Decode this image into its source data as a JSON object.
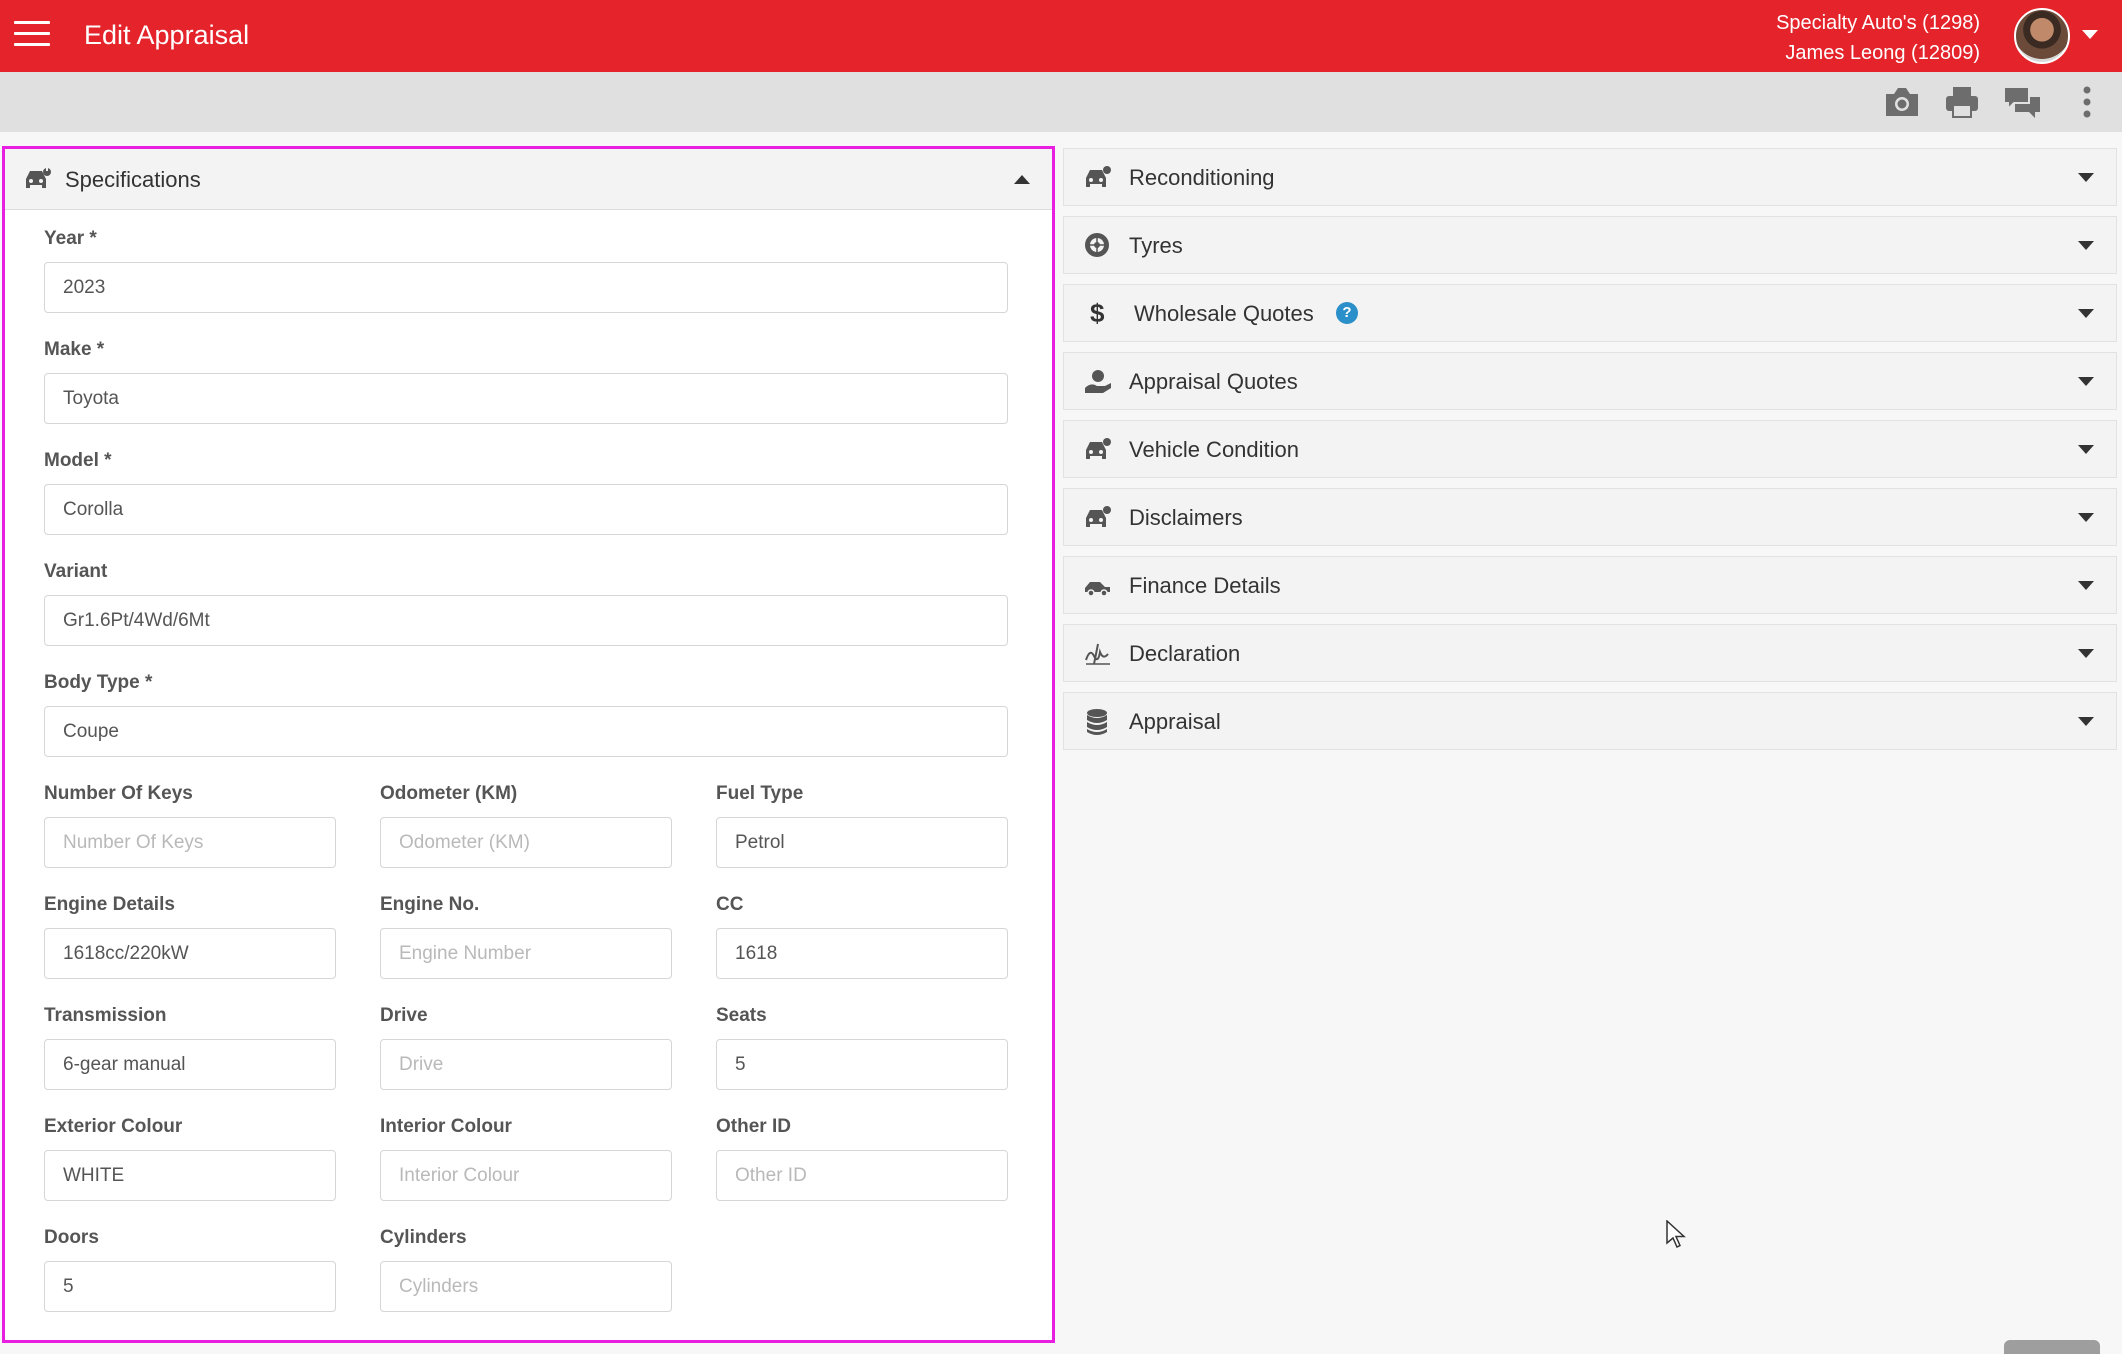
{
  "header": {
    "title": "Edit Appraisal",
    "dealer": "Specialty Auto's (1298)",
    "user": "James Leong (12809)"
  },
  "colors": {
    "brand": "#e4232b",
    "highlight": "#e81ee0",
    "help": "#2b8fc9"
  },
  "toolbar_icons": [
    "camera-icon",
    "print-icon",
    "chat-icon",
    "more-vertical-icon"
  ],
  "specifications": {
    "title": "Specifications",
    "fields": {
      "year": {
        "label": "Year *",
        "value": "2023",
        "placeholder": ""
      },
      "make": {
        "label": "Make *",
        "value": "Toyota",
        "placeholder": ""
      },
      "model": {
        "label": "Model *",
        "value": "Corolla",
        "placeholder": ""
      },
      "variant": {
        "label": "Variant",
        "value": "Gr1.6Pt/4Wd/6Mt",
        "placeholder": ""
      },
      "body_type": {
        "label": "Body Type *",
        "value": "Coupe",
        "placeholder": ""
      },
      "keys": {
        "label": "Number Of Keys",
        "value": "",
        "placeholder": "Number Of Keys"
      },
      "odometer": {
        "label": "Odometer (KM)",
        "value": "",
        "placeholder": "Odometer (KM)"
      },
      "fuel": {
        "label": "Fuel Type",
        "value": "Petrol",
        "placeholder": ""
      },
      "engine_details": {
        "label": "Engine Details",
        "value": "1618cc/220kW",
        "placeholder": ""
      },
      "engine_no": {
        "label": "Engine No.",
        "value": "",
        "placeholder": "Engine Number"
      },
      "cc": {
        "label": "CC",
        "value": "1618",
        "placeholder": ""
      },
      "transmission": {
        "label": "Transmission",
        "value": "6-gear manual",
        "placeholder": ""
      },
      "drive": {
        "label": "Drive",
        "value": "",
        "placeholder": "Drive"
      },
      "seats": {
        "label": "Seats",
        "value": "5",
        "placeholder": ""
      },
      "ext_colour": {
        "label": "Exterior Colour",
        "value": "WHITE",
        "placeholder": ""
      },
      "int_colour": {
        "label": "Interior Colour",
        "value": "",
        "placeholder": "Interior Colour"
      },
      "other_id": {
        "label": "Other ID",
        "value": "",
        "placeholder": "Other ID"
      },
      "doors": {
        "label": "Doors",
        "value": "5",
        "placeholder": ""
      },
      "cylinders": {
        "label": "Cylinders",
        "value": "",
        "placeholder": "Cylinders"
      }
    }
  },
  "sections": [
    {
      "label": "Reconditioning",
      "icon": "car-wrench-icon"
    },
    {
      "label": "Tyres",
      "icon": "tyre-icon"
    },
    {
      "label": "Wholesale Quotes",
      "icon": "dollar-icon",
      "help": "?"
    },
    {
      "label": "Appraisal Quotes",
      "icon": "hand-coin-icon"
    },
    {
      "label": "Vehicle Condition",
      "icon": "car-wrench-icon"
    },
    {
      "label": "Disclaimers",
      "icon": "car-wrench-icon"
    },
    {
      "label": "Finance Details",
      "icon": "car-side-icon"
    },
    {
      "label": "Declaration",
      "icon": "signature-icon"
    },
    {
      "label": "Appraisal",
      "icon": "database-icon"
    }
  ]
}
